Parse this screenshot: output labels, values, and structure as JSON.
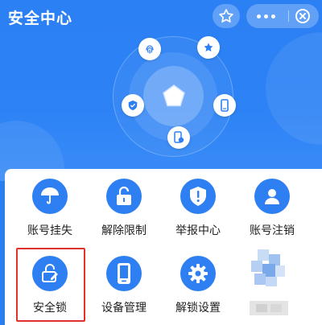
{
  "header": {
    "title": "安全中心",
    "star_icon": "star-icon",
    "more_icon": "more-dots-icon",
    "close_icon": "close-circle-icon"
  },
  "hero": {
    "center_icon": "pentagon-shield-icon",
    "orbit_icons": [
      "fingerprint-icon",
      "star-badge-icon",
      "shield-check-icon",
      "phone-icon",
      "device-lock-icon"
    ]
  },
  "grid": {
    "items": [
      {
        "label": "账号挂失",
        "icon": "umbrella-icon"
      },
      {
        "label": "解除限制",
        "icon": "unlock-icon"
      },
      {
        "label": "举报中心",
        "icon": "report-shield-icon"
      },
      {
        "label": "账号注销",
        "icon": "user-icon"
      },
      {
        "label": "安全锁",
        "icon": "edit-lock-icon"
      },
      {
        "label": "设备管理",
        "icon": "phone-device-icon"
      },
      {
        "label": "解锁设置",
        "icon": "gear-icon"
      }
    ]
  },
  "colors": {
    "header_bg": "#2b80f4",
    "icon_bg": "#2d7ff2",
    "highlight": "#e0312a"
  }
}
